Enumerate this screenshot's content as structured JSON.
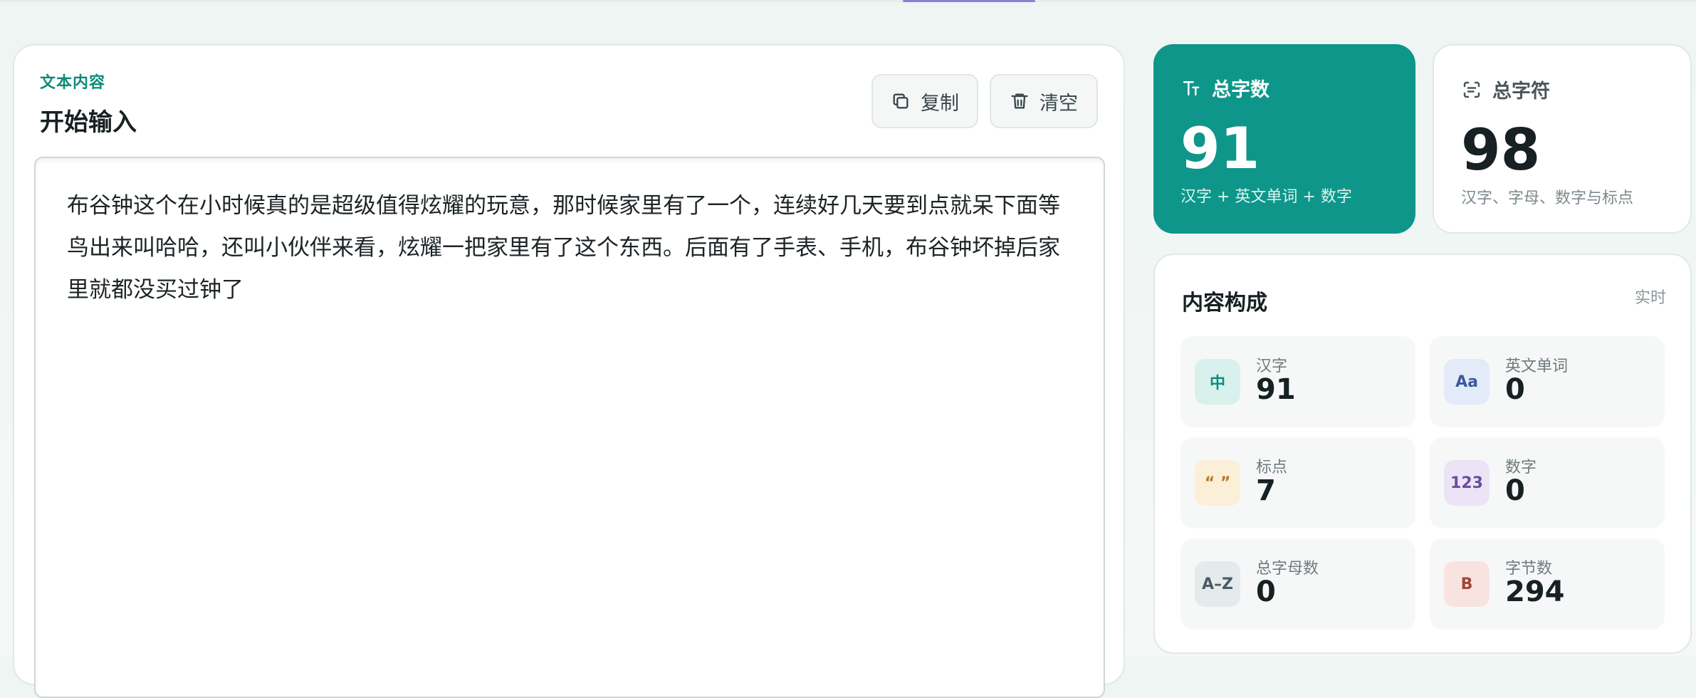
{
  "editor": {
    "eyebrow": "文本内容",
    "title": "开始输入",
    "copy_label": "复制",
    "clear_label": "清空",
    "text": "布谷钟这个在小时候真的是超级值得炫耀的玩意，那时候家里有了一个，连续好几天要到点就呆下面等鸟出来叫哈哈，还叫小伙伴来看，炫耀一把家里有了这个东西。后面有了手表、手机，布谷钟坏掉后家里就都没买过钟了"
  },
  "stats": {
    "total_chars": {
      "label": "总字数",
      "value": "91",
      "desc": "汉字 + 英文单词 + 数字",
      "icon": "text-size-icon"
    },
    "total_symbols": {
      "label": "总字符",
      "value": "98",
      "desc": "汉字、字母、数字与标点",
      "icon": "scan-text-icon"
    }
  },
  "composition": {
    "title": "内容构成",
    "live": "实时",
    "items": [
      {
        "badge": "中",
        "label": "汉字",
        "value": "91",
        "badge_bg": "#d9f1ec",
        "badge_fg": "#0e8a7c"
      },
      {
        "badge": "Aa",
        "label": "英文单词",
        "value": "0",
        "badge_bg": "#e3ebf8",
        "badge_fg": "#3a5a9a"
      },
      {
        "badge": "“ ”",
        "label": "标点",
        "value": "7",
        "badge_bg": "#fcefd7",
        "badge_fg": "#b47a2a"
      },
      {
        "badge": "123",
        "label": "数字",
        "value": "0",
        "badge_bg": "#ece4f6",
        "badge_fg": "#6b4c9c"
      },
      {
        "badge": "A–Z",
        "label": "总字母数",
        "value": "0",
        "badge_bg": "#e5eaed",
        "badge_fg": "#4b5b66"
      },
      {
        "badge": "B",
        "label": "字节数",
        "value": "294",
        "badge_bg": "#f8e3e0",
        "badge_fg": "#a0473a"
      }
    ]
  }
}
